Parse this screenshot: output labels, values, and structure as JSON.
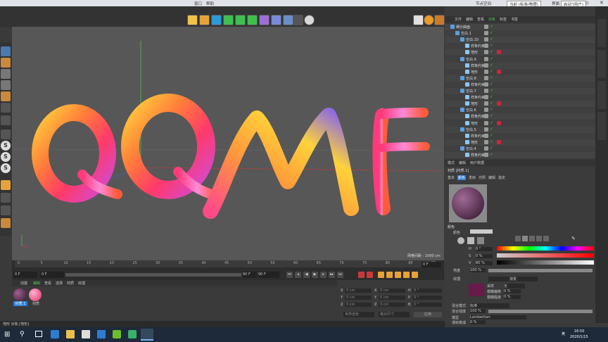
{
  "topbar": {
    "menu_window": "窗口",
    "menu_help": "帮助",
    "layout_label": "节点空间",
    "layout_value": "当前 (标准/物理)",
    "interface_label": "界面",
    "interface_value": "启动 (用户)"
  },
  "viewport": {
    "grid_label": "网格间距 : 1000 cm",
    "letters": [
      "Q",
      "Q",
      "M",
      "F"
    ]
  },
  "timeline": {
    "ticks": [
      "0",
      "5",
      "10",
      "15",
      "20",
      "25",
      "30",
      "35",
      "40",
      "45",
      "50",
      "55",
      "60",
      "65",
      "70",
      "75",
      "80",
      "85",
      "90"
    ],
    "frame_current": "0 F",
    "frame_start": "0 F",
    "frame_end": "90 F",
    "frame_end2": "90 F",
    "frame_right": "0 F"
  },
  "matmgr": {
    "tabs": [
      "创建",
      "编辑",
      "查看",
      "选择",
      "材质",
      "纹理"
    ],
    "materials": [
      {
        "label": "材质.1",
        "color": "#5a2a52"
      },
      {
        "label": "材质",
        "color": "#e05a6a"
      }
    ]
  },
  "coords": {
    "rows": [
      {
        "a": "X",
        "av": "0 cm",
        "b": "X",
        "bv": "0 cm",
        "c": "H",
        "cv": "0 °"
      },
      {
        "a": "Y",
        "av": "0 cm",
        "b": "Y",
        "bv": "0 cm",
        "c": "P",
        "cv": "0 °"
      },
      {
        "a": "Z",
        "av": "0 cm",
        "b": "Z",
        "bv": "0 cm",
        "c": "B",
        "cv": "0 °"
      }
    ],
    "mode1": "世界坐标",
    "mode2": "绝对尺寸",
    "apply": "应用"
  },
  "objmgr": {
    "menu": [
      "文件",
      "编辑",
      "查看",
      "对象",
      "标签",
      "书签"
    ],
    "rows": [
      {
        "name": "细分曲面",
        "indent": 0,
        "tag": false
      },
      {
        "name": "空白.1",
        "indent": 1,
        "tag": false
      },
      {
        "name": "空白.10",
        "indent": 2,
        "tag": false
      },
      {
        "name": "样条约束",
        "indent": 3,
        "tag": false
      },
      {
        "name": "地形",
        "indent": 3,
        "tag": true
      },
      {
        "name": "空白.9",
        "indent": 2,
        "tag": false
      },
      {
        "name": "样条约束",
        "indent": 3,
        "tag": false
      },
      {
        "name": "地形",
        "indent": 3,
        "tag": true
      },
      {
        "name": "空白.8",
        "indent": 2,
        "tag": false
      },
      {
        "name": "样条约束",
        "indent": 3,
        "tag": false
      },
      {
        "name": "空白.7",
        "indent": 2,
        "tag": false
      },
      {
        "name": "样条约束",
        "indent": 3,
        "tag": false
      },
      {
        "name": "地形",
        "indent": 3,
        "tag": true
      },
      {
        "name": "空白.6",
        "indent": 2,
        "tag": false
      },
      {
        "name": "样条约束",
        "indent": 3,
        "tag": false
      },
      {
        "name": "地形",
        "indent": 3,
        "tag": true
      },
      {
        "name": "空白.5",
        "indent": 2,
        "tag": false
      },
      {
        "name": "样条约束",
        "indent": 3,
        "tag": false
      },
      {
        "name": "地形",
        "indent": 3,
        "tag": true
      },
      {
        "name": "空白.4",
        "indent": 2,
        "tag": false
      },
      {
        "name": "样条约束",
        "indent": 3,
        "tag": false
      }
    ]
  },
  "attrmgr": {
    "menu": [
      "模式",
      "编辑",
      "用户数据"
    ],
    "title": "材质 [材质.1]",
    "tabs": [
      "基本",
      "颜色",
      "发射",
      "光照",
      "编辑",
      "指定"
    ],
    "section_color": "颜色",
    "color_label": "颜色",
    "h_label": "H",
    "h_value": "0 °",
    "s_label": "S",
    "s_value": "0 %",
    "v_label": "V",
    "v_value": "80 %",
    "brightness_label": "亮度",
    "brightness_value": "100 %",
    "texture_label": "纹理",
    "texture_value": "渐变",
    "sample_label": "采样",
    "sample_value": "无",
    "blur_offset_label": "模糊偏移",
    "blur_offset_value": "0 %",
    "blur_scale_label": "模糊程度",
    "blur_scale_value": "0 %",
    "mix_mode_label": "混合模式",
    "mix_mode_value": "标准",
    "mix_strength_label": "混合强度",
    "mix_strength_value": "100 %",
    "model_label": "模型",
    "model_value": "Lambertian",
    "diffuse_label": "漫射衰减",
    "diffuse_value": "0 %"
  },
  "statusbar": {
    "text": "地形 对象 [地形]"
  },
  "taskbar": {
    "ime": "英",
    "time": "16:50",
    "date": "2020/1/15"
  },
  "colors": {
    "green": "#49c94b",
    "accent": "#2d7cd1",
    "tag_red": "#c8283c"
  }
}
